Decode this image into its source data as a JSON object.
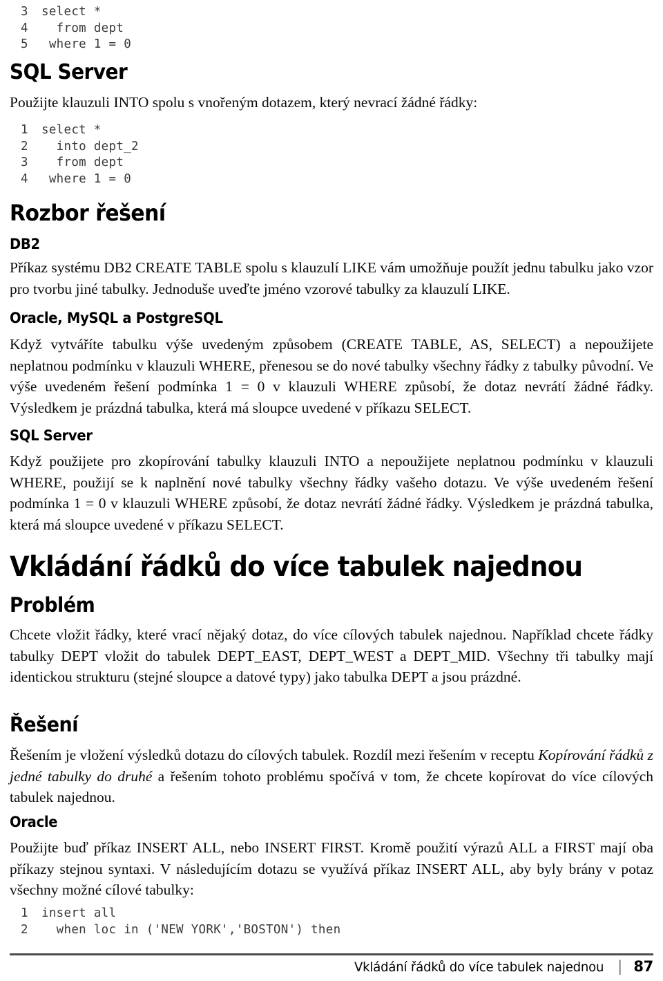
{
  "page": {
    "number": "87",
    "footer_title": "Vkládání řádků do více tabulek najednou",
    "footer_separator": "|"
  },
  "blocks": {
    "code_top": {
      "lines": [
        {
          "n": "3",
          "text": "select *"
        },
        {
          "n": "4",
          "text": "  from dept"
        },
        {
          "n": "5",
          "text": " where 1 = 0"
        }
      ]
    },
    "sqlserver_heading_1": "SQL Server",
    "sqlserver_intro": "Použijte klauzuli INTO spolu s vnořeným dotazem, který nevrací žádné řádky:",
    "code_sqlserver": {
      "lines": [
        {
          "n": "1",
          "text": "select *"
        },
        {
          "n": "2",
          "text": "  into dept_2"
        },
        {
          "n": "3",
          "text": "  from dept"
        },
        {
          "n": "4",
          "text": " where 1 = 0"
        }
      ]
    },
    "rozbor_heading": "Rozbor řešení",
    "db2_heading": "DB2",
    "db2_body": "Příkaz systému DB2 CREATE TABLE spolu s klauzulí LIKE vám umožňuje použít jednu tabulku jako vzor pro tvorbu jiné tabulky. Jednoduše uveďte jméno vzorové tabulky za klauzulí LIKE.",
    "oracle_mysql_pg_heading": "Oracle, MySQL a PostgreSQL",
    "oracle_mysql_pg_body": "Když vytváříte tabulku výše uvedeným způsobem (CREATE TABLE, AS, SELECT) a nepoužijete neplatnou podmínku v klauzuli WHERE, přenesou se do nové tabulky všechny řádky z tabulky původní. Ve výše uvedeném řešení podmínka 1 = 0 v klauzuli WHERE způsobí, že dotaz nevrátí žádné řádky. Výsledkem je prázdná tabulka, která má sloupce uvedené v příkazu SELECT.",
    "sqlserver_heading_2": "SQL Server",
    "sqlserver_body": "Když použijete pro zkopírování tabulky klauzuli INTO a nepoužijete neplatnou podmínku v klauzuli WHERE, použijí se k naplnění nové tabulky všechny řádky vašeho dotazu. Ve výše uvedeném řešení podmínka 1 = 0 v klauzuli WHERE způsobí, že dotaz nevrátí žádné řádky. Výsledkem je prázdná tabulka, která má sloupce uvedené v příkazu SELECT.",
    "section_heading": "Vkládání řádků do více tabulek najednou",
    "problem_heading": "Problém",
    "problem_body": "Chcete vložit řádky, které vrací nějaký dotaz, do více cílových tabulek najednou. Například chcete řádky tabulky DEPT vložit do tabulek DEPT_EAST, DEPT_WEST a DEPT_MID. Všechny tři tabulky mají identickou strukturu (stejné sloupce a datové typy) jako tabulka DEPT a jsou prázdné.",
    "reseni_heading": "Řešení",
    "reseni_body_part1": "Řešením je vložení výsledků dotazu do cílových tabulek. Rozdíl mezi řešením v receptu ",
    "reseni_body_italic": "Kopírování řádků z jedné tabulky do druhé",
    "reseni_body_part2": " a řešením tohoto problému spočívá v tom, že chcete kopírovat do více cílových tabulek najednou.",
    "oracle_heading": "Oracle",
    "oracle_body": "Použijte buď příkaz INSERT ALL, nebo INSERT FIRST. Kromě použití výrazů ALL a FIRST mají oba příkazy stejnou syntaxi. V následujícím dotazu se využívá příkaz INSERT ALL, aby byly brány v potaz všechny možné cílové tabulky:",
    "code_oracle": {
      "lines": [
        {
          "n": "1",
          "text": "insert all"
        },
        {
          "n": "2",
          "text": "  when loc in ('NEW YORK','BOSTON') then"
        }
      ]
    }
  }
}
